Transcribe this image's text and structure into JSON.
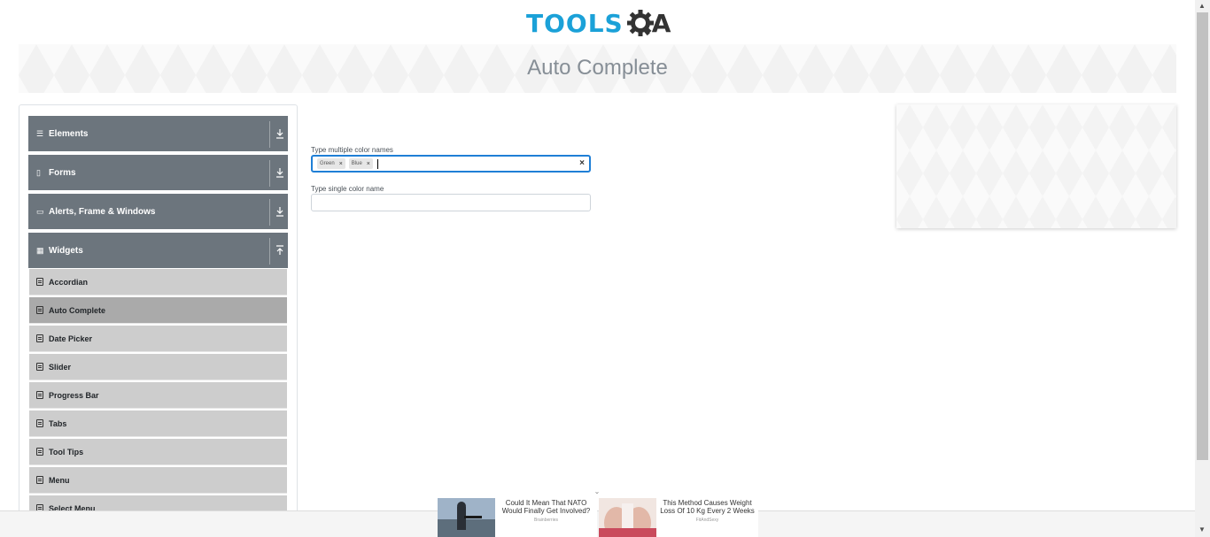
{
  "header": {
    "logo_text": "TOOLS",
    "logo_suffix": "A",
    "page_title": "Auto Complete"
  },
  "sidebar": {
    "groups": [
      {
        "label": "Elements",
        "icon": "hamburger-icon",
        "expanded": false
      },
      {
        "label": "Forms",
        "icon": "document-icon",
        "expanded": false
      },
      {
        "label": "Alerts, Frame & Windows",
        "icon": "window-icon",
        "expanded": false
      },
      {
        "label": "Widgets",
        "icon": "grid-icon",
        "expanded": true
      }
    ],
    "items": [
      {
        "label": "Accordian",
        "active": false
      },
      {
        "label": "Auto Complete",
        "active": true
      },
      {
        "label": "Date Picker",
        "active": false
      },
      {
        "label": "Slider",
        "active": false
      },
      {
        "label": "Progress Bar",
        "active": false
      },
      {
        "label": "Tabs",
        "active": false
      },
      {
        "label": "Tool Tips",
        "active": false
      },
      {
        "label": "Menu",
        "active": false
      },
      {
        "label": "Select Menu",
        "active": false
      }
    ]
  },
  "form": {
    "multi_label": "Type multiple color names",
    "chips": [
      {
        "label": "Green",
        "remove": "×"
      },
      {
        "label": "Blue",
        "remove": "×"
      }
    ],
    "clear": "×",
    "single_label": "Type single color name",
    "single_value": ""
  },
  "ads": [
    {
      "headline": "Could It Mean That NATO Would Finally Get Involved?",
      "source": "Brainberries"
    },
    {
      "headline": "This Method Causes Weight Loss Of 10 Kg Every 2 Weeks",
      "source": "FitAndSexy"
    }
  ],
  "ad_collapse": "⌄",
  "colors": {
    "brand": "#1ba1d8",
    "sidebar_group": "#6c757d",
    "sidebar_item": "#cdcdcd",
    "sidebar_item_active": "#aaaaaa",
    "focus_border": "#1f7fd6"
  }
}
